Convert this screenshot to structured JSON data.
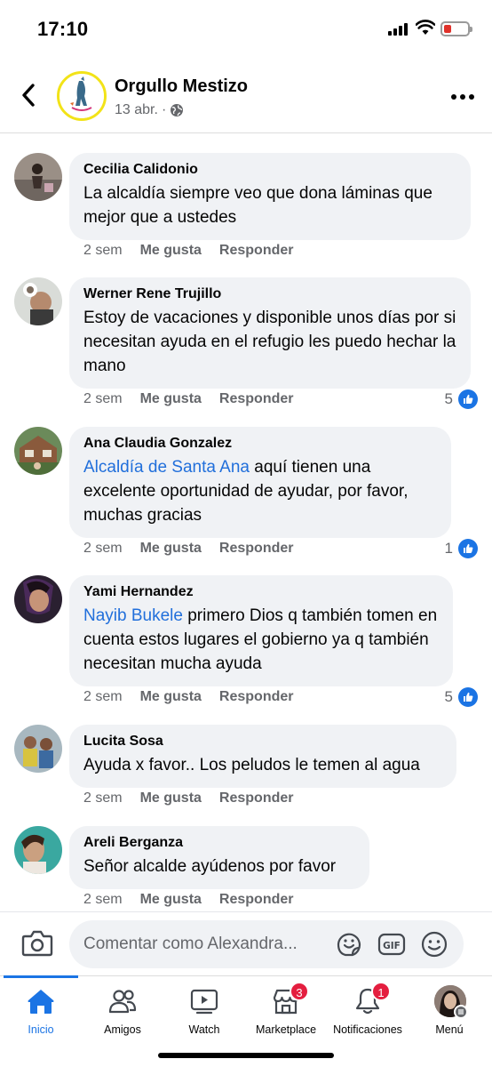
{
  "status_bar": {
    "time": "17:10"
  },
  "header": {
    "page_name": "Orgullo Mestizo",
    "date": "13 abr.",
    "separator": "·"
  },
  "comments": [
    {
      "author": "Cecilia Calidonio",
      "mention": "",
      "text": "La alcaldía siempre veo que dona láminas que mejor que a ustedes",
      "time": "2 sem",
      "like_label": "Me gusta",
      "reply_label": "Responder",
      "reaction_count": ""
    },
    {
      "author": "Werner Rene Trujillo",
      "mention": "",
      "text": "Estoy de vacaciones y disponible unos días por si necesitan ayuda en el refugio les puedo hechar la mano",
      "time": "2 sem",
      "like_label": "Me gusta",
      "reply_label": "Responder",
      "reaction_count": "5"
    },
    {
      "author": "Ana Claudia Gonzalez",
      "mention": "Alcaldía de Santa Ana",
      "text": " aquí tienen una excelente oportunidad de ayudar, por favor, muchas gracias",
      "time": "2 sem",
      "like_label": "Me gusta",
      "reply_label": "Responder",
      "reaction_count": "1"
    },
    {
      "author": "Yami Hernandez",
      "mention": "Nayib Bukele",
      "text": " primero Dios q también tomen en cuenta estos lugares  el gobierno ya q también necesitan mucha ayuda",
      "time": "2 sem",
      "like_label": "Me gusta",
      "reply_label": "Responder",
      "reaction_count": "5"
    },
    {
      "author": "Lucita Sosa",
      "mention": "",
      "text": "Ayuda x favor.. Los peludos le temen al agua",
      "time": "2 sem",
      "like_label": "Me gusta",
      "reply_label": "Responder",
      "reaction_count": ""
    },
    {
      "author": "Areli Berganza",
      "mention": "",
      "text": "Señor alcalde ayúdenos por favor",
      "time": "2 sem",
      "like_label": "Me gusta",
      "reply_label": "Responder",
      "reaction_count": ""
    }
  ],
  "composer": {
    "placeholder": "Comentar como Alexandra..."
  },
  "nav": {
    "tabs": [
      {
        "label": "Inicio",
        "icon": "home-icon",
        "active": true,
        "badge": ""
      },
      {
        "label": "Amigos",
        "icon": "friends-icon",
        "active": false,
        "badge": ""
      },
      {
        "label": "Watch",
        "icon": "watch-icon",
        "active": false,
        "badge": ""
      },
      {
        "label": "Marketplace",
        "icon": "marketplace-icon",
        "active": false,
        "badge": "3"
      },
      {
        "label": "Notificaciones",
        "icon": "bell-icon",
        "active": false,
        "badge": "1"
      },
      {
        "label": "Menú",
        "icon": "profile-menu-icon",
        "active": false,
        "badge": ""
      }
    ]
  },
  "colors": {
    "accent": "#1b74e4",
    "link": "#216fdb",
    "badge": "#e41e3f",
    "bubble": "#f0f2f5",
    "secondary_text": "#65676b"
  }
}
